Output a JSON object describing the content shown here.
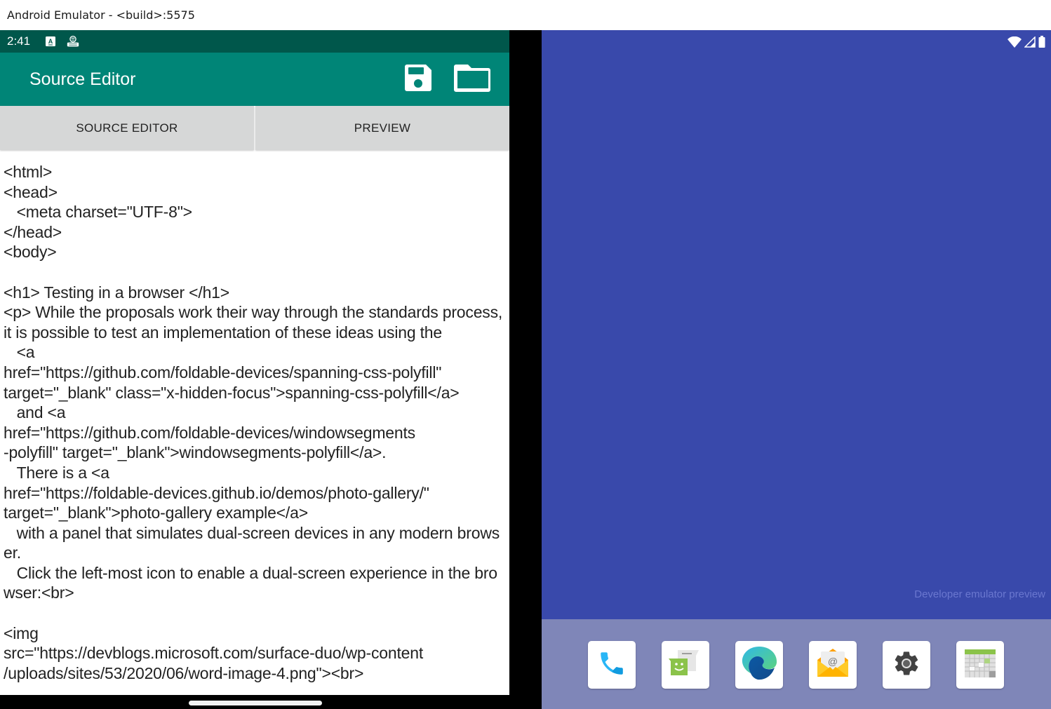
{
  "window": {
    "title": "Android Emulator - <build>:5575"
  },
  "left_screen": {
    "status_bar": {
      "time": "2:41",
      "icons": [
        "keyboard-a-icon",
        "android-debug-icon"
      ]
    },
    "app_bar": {
      "title": "Source Editor",
      "actions": [
        {
          "name": "save",
          "icon": "floppy-disk-icon"
        },
        {
          "name": "open",
          "icon": "folder-icon"
        }
      ]
    },
    "tabs": [
      {
        "label": "SOURCE EDITOR"
      },
      {
        "label": "PREVIEW"
      }
    ],
    "editor": {
      "content": "<html>\n<head>\n   <meta charset=\"UTF-8\">\n</head>\n<body>\n\n<h1> Testing in a browser </h1>\n<p> While the proposals work their way through the standards process, it is possible to test an implementation of these ideas using the\n   <a\nhref=\"https://github.com/foldable-devices/spanning-css-polyfill\"\ntarget=\"_blank\" class=\"x-hidden-focus\">spanning-css-polyfill</a>\n   and <a\nhref=\"https://github.com/foldable-devices/windowsegments\n-polyfill\" target=\"_blank\">windowsegments-polyfill</a>.\n   There is a <a\nhref=\"https://foldable-devices.github.io/demos/photo-gallery/\"\ntarget=\"_blank\">photo-gallery example</a>\n   with a panel that simulates dual-screen devices in any modern browser.\n   Click the left-most icon to enable a dual-screen experience in the browser:<br>\n\n<img\nsrc=\"https://devblogs.microsoft.com/surface-duo/wp-content\n/uploads/sites/53/2020/06/word-image-4.png\"><br>"
    }
  },
  "right_screen": {
    "status_icons": [
      "wifi-icon",
      "cell-signal-icon",
      "battery-icon"
    ],
    "watermark": "Developer emulator preview",
    "dock_apps": [
      {
        "name": "Phone",
        "icon": "phone-icon"
      },
      {
        "name": "Messages",
        "icon": "messages-icon"
      },
      {
        "name": "Edge",
        "icon": "edge-browser-icon"
      },
      {
        "name": "Email",
        "icon": "email-icon"
      },
      {
        "name": "Settings",
        "icon": "settings-gear-icon"
      },
      {
        "name": "Calendar",
        "icon": "calendar-icon"
      }
    ]
  },
  "colors": {
    "status_bar": "#00574b",
    "app_bar": "#008577",
    "tab_bg": "#d6d7d7",
    "right_wallpaper": "#3949ab",
    "dock_bg": "#7f86b8"
  }
}
